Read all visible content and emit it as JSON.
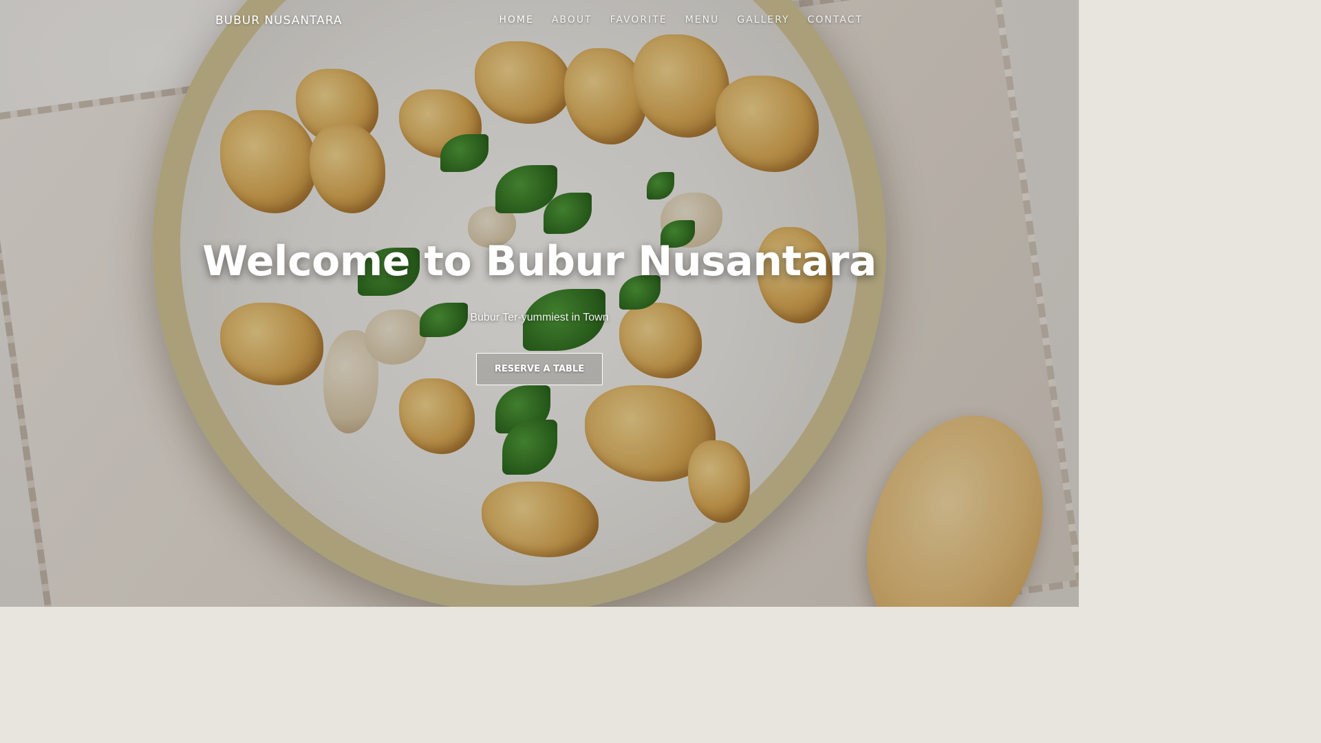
{
  "brand": {
    "name": "BUBUR NUSANTARA"
  },
  "nav": {
    "items": [
      {
        "label": "HOME",
        "active": true
      },
      {
        "label": "ABOUT",
        "active": false
      },
      {
        "label": "FAVORITE",
        "active": false
      },
      {
        "label": "MENU",
        "active": false
      },
      {
        "label": "GALLERY",
        "active": false
      },
      {
        "label": "CONTACT",
        "active": false
      }
    ]
  },
  "hero": {
    "title": "Welcome to Bubur Nusantara",
    "subtitle": "Bubur Ter-yummiest in Town",
    "cta_label": "RESERVE A TABLE",
    "background_image": "bubur-ayam-bowl-photo"
  },
  "colors": {
    "text": "#ffffff",
    "background_tint": "#e8e4de"
  }
}
